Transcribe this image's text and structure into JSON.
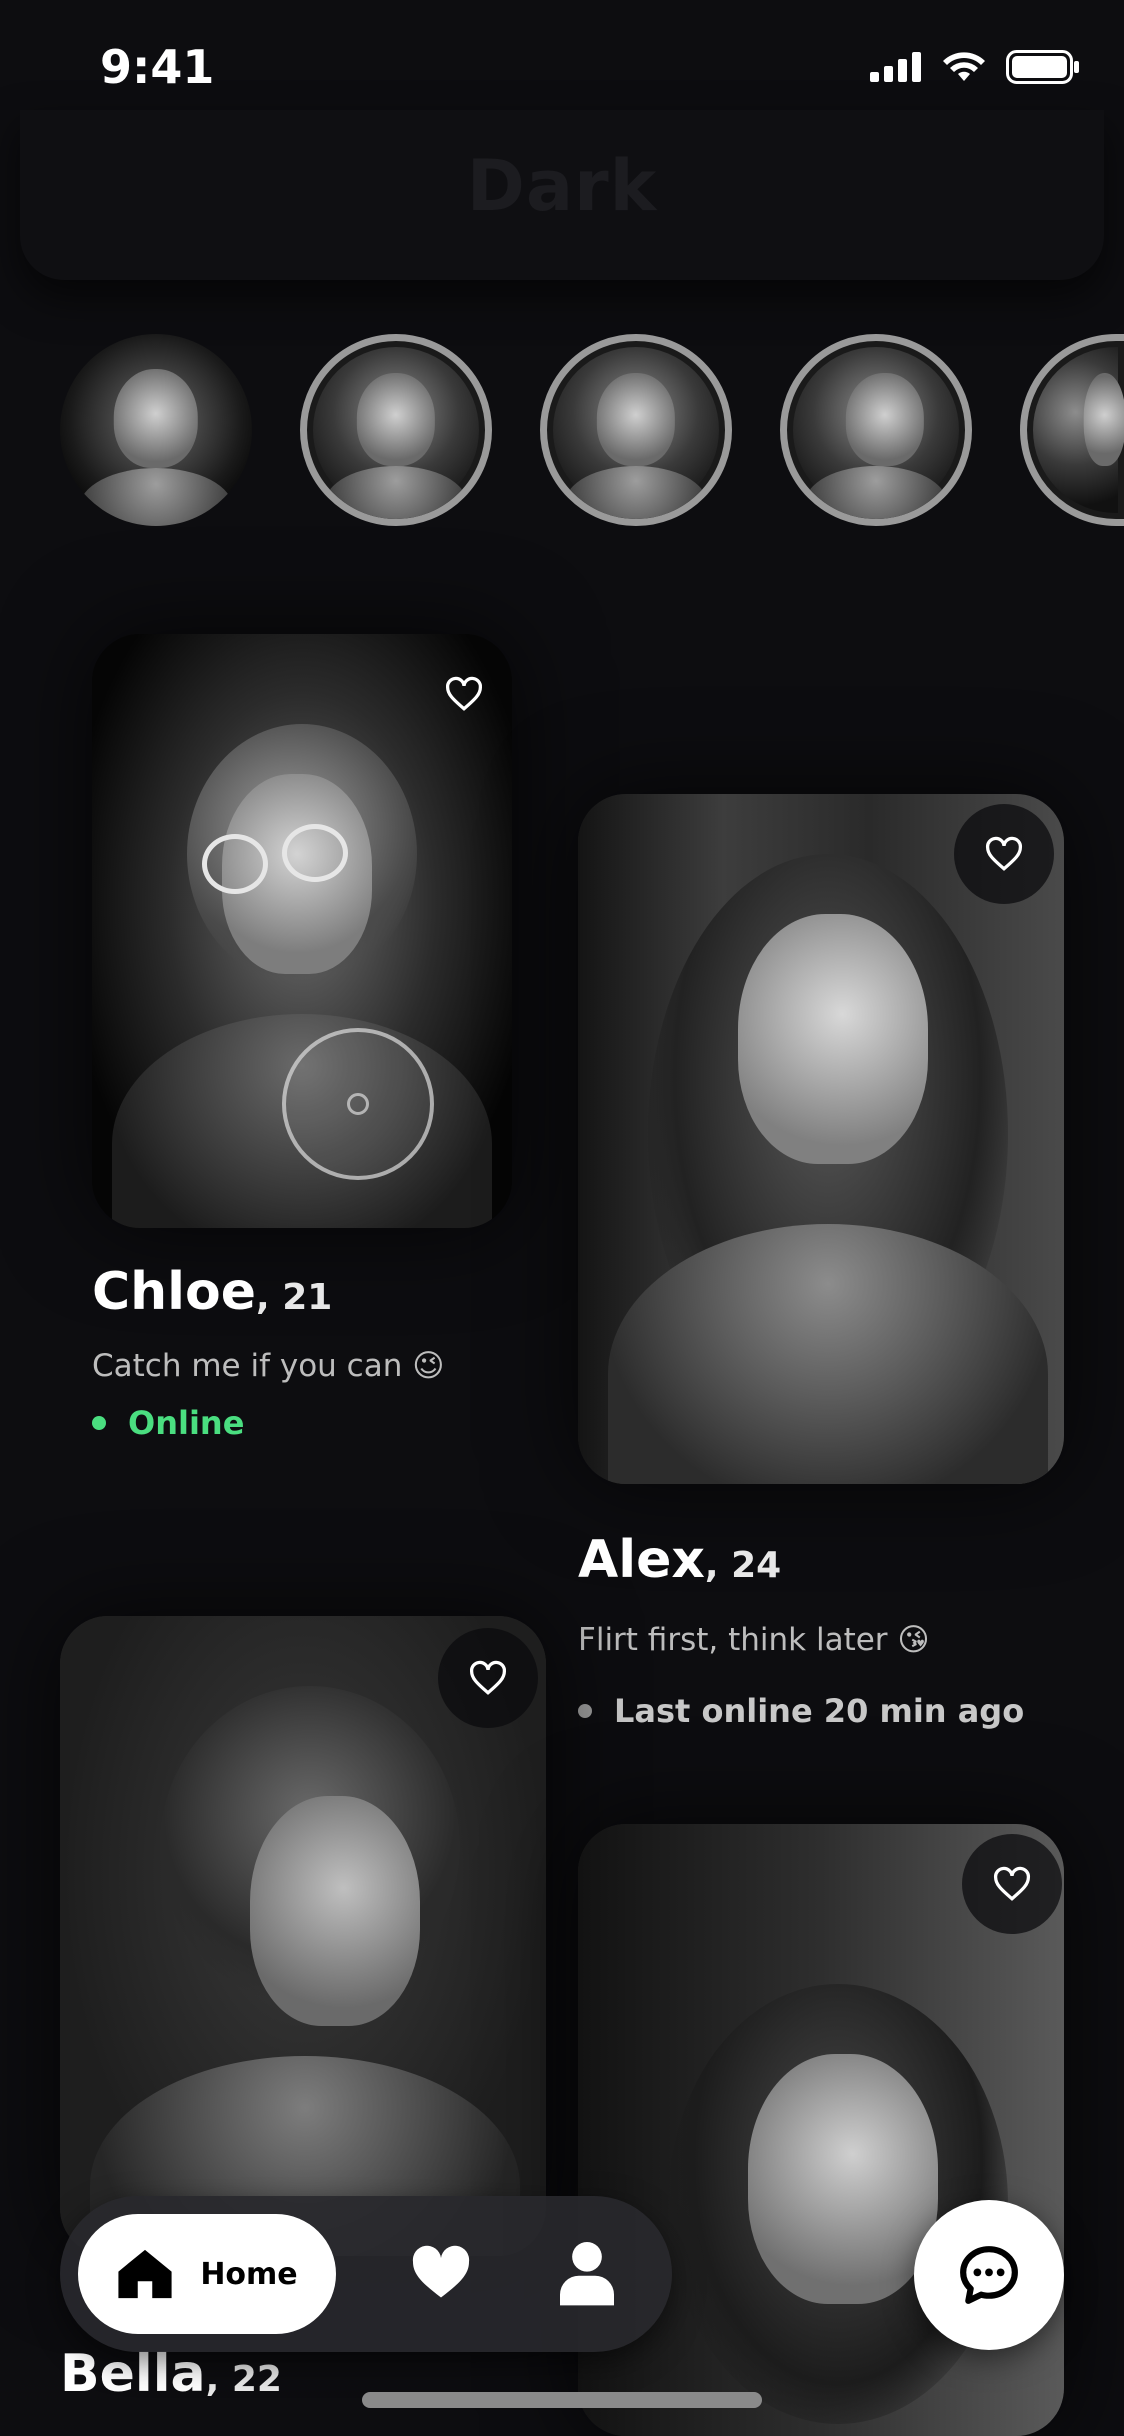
{
  "status_bar": {
    "time": "9:41"
  },
  "header": {
    "title": "Dark"
  },
  "stories": [
    {
      "name": "story-1"
    },
    {
      "name": "story-2"
    },
    {
      "name": "story-3"
    },
    {
      "name": "story-4"
    },
    {
      "name": "story-5"
    }
  ],
  "profiles": [
    {
      "name": "Chloe",
      "age": ", 21",
      "bio": "Catch me if you can 😉",
      "status": "Online",
      "status_color": "#4ade80"
    },
    {
      "name": "Alex",
      "age": ", 24",
      "bio": "Flirt first, think later 😘",
      "status": "Last online 20 min ago",
      "status_color": "#9a9a9a"
    },
    {
      "name": "Bella",
      "age": ", 22"
    },
    {
      "name": ""
    }
  ],
  "nav": {
    "home_label": "Home"
  },
  "icons": {
    "status": [
      "signal-icon",
      "wifi-icon",
      "battery-icon"
    ],
    "card": "heart-outline-icon",
    "nav": [
      "home-icon",
      "heart-icon",
      "person-icon"
    ],
    "fab": "chat-icon"
  },
  "colors": {
    "background": "#0d0d10",
    "online": "#4ade80",
    "accent": "#ffffff"
  }
}
